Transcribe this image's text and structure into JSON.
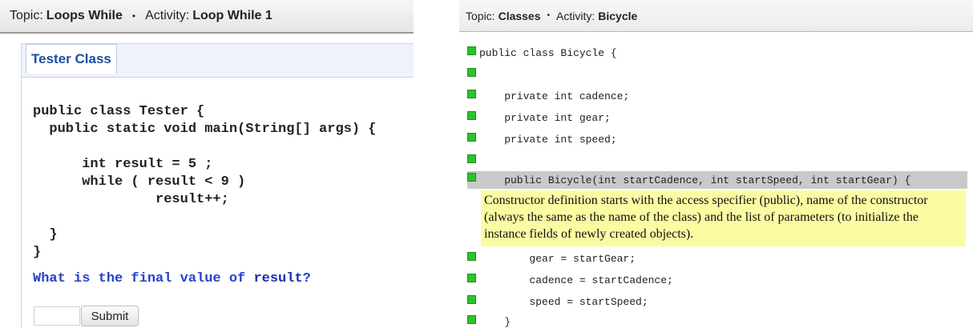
{
  "left": {
    "topic_label": "Topic:",
    "topic_value": "Loops While",
    "activity_label": "Activity:",
    "activity_value": "Loop While 1",
    "tab_label": "Tester Class",
    "code_lines": [
      "public class Tester {",
      "  public static void main(String[] args) {",
      "",
      "      int result = 5 ;",
      "      while ( result < 9 )",
      "               result++;",
      "",
      "  }",
      "}"
    ],
    "question_prefix": "What is the final value of ",
    "question_keyword": "result",
    "question_suffix": "?",
    "answer_value": "",
    "submit_label": "Submit"
  },
  "right": {
    "topic_label": "Topic:",
    "topic_value": "Classes",
    "activity_label": "Activity:",
    "activity_value": "Bicycle",
    "code_lines": [
      "public class Bicycle {",
      "",
      "    private int cadence;",
      "    private int gear;",
      "    private int speed;",
      "",
      "    public Bicycle(int startCadence, int startSpeed, int startGear) {",
      "        gear = startGear;",
      "        cadence = startCadence;",
      "        speed = startSpeed;",
      "    }"
    ],
    "note": "Constructor definition starts with the access specifier (public), name of the constructor (always the same as the name of the class) and the list of parameters (to initialize the instance fields of newly created objects).",
    "marker_color": "#2ec12e",
    "highlight_color": "#fbfba3"
  }
}
